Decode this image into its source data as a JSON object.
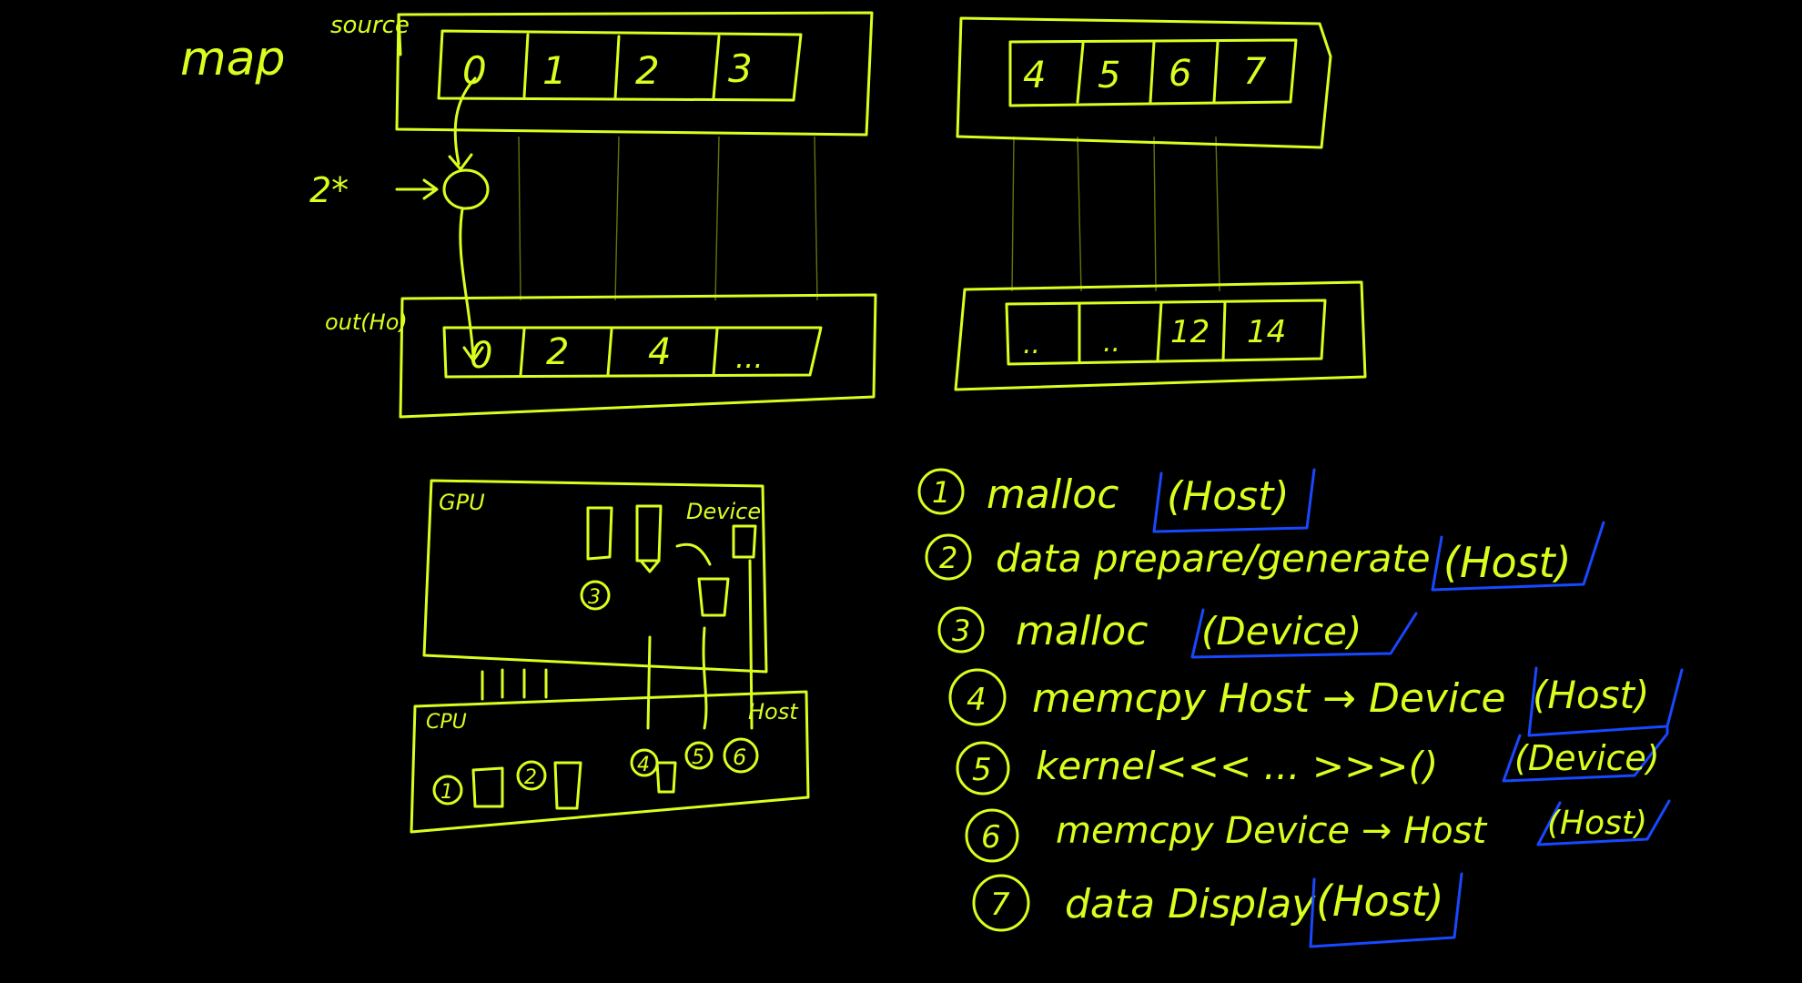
{
  "colors": {
    "background": "#000000",
    "ink": "#d9ff1f",
    "highlight": "#1848ff"
  },
  "map": {
    "title": "map",
    "source_label": "source",
    "output_label": "out(Ho)",
    "op_label": "2*",
    "source_left": [
      "0",
      "1",
      "2",
      "3"
    ],
    "source_right": [
      "4",
      "5",
      "6",
      "7"
    ],
    "output_left": [
      "0",
      "2",
      "4",
      "..."
    ],
    "output_right": [
      "..",
      "..",
      "12",
      "14"
    ]
  },
  "hardware": {
    "gpu_label": "GPU",
    "cpu_label": "CPU",
    "device_label": "Device",
    "host_label": "Host",
    "markers": [
      "1",
      "2",
      "3",
      "4",
      "5",
      "6"
    ]
  },
  "steps": [
    {
      "num": "1",
      "text": "malloc",
      "tag": "(Host)"
    },
    {
      "num": "2",
      "text": "data prepare/generate",
      "tag": "(Host)"
    },
    {
      "num": "3",
      "text": "malloc",
      "tag": "(Device)"
    },
    {
      "num": "4",
      "text": "memcpy Host → Device",
      "tag": "(Host)"
    },
    {
      "num": "5",
      "text": "kernel<<< ... >>>()",
      "tag": "(Device)"
    },
    {
      "num": "6",
      "text": "memcpy Device → Host",
      "tag": "(Host)"
    },
    {
      "num": "7",
      "text": "data Display",
      "tag": "(Host)"
    }
  ]
}
